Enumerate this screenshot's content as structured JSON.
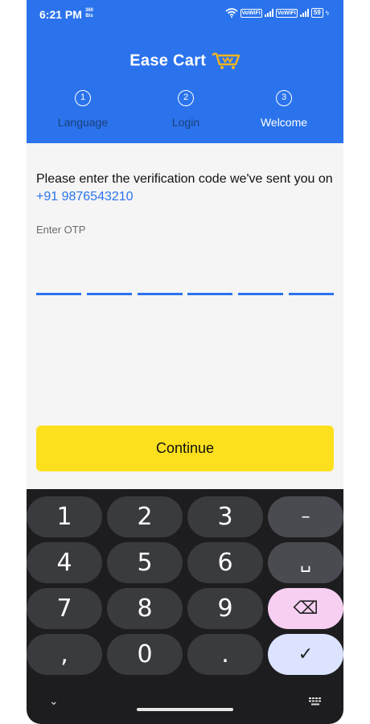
{
  "status_bar": {
    "time": "6:21 PM",
    "speed_value": "360",
    "speed_unit": "B/s",
    "vowifi_1": "VoWiFi",
    "vowifi_2": "VoWiFi",
    "battery": "59"
  },
  "header": {
    "brand_name": "Ease Cart",
    "brand_color": "#f3b51b",
    "bg_color": "#2b73ec",
    "steps": [
      {
        "number": "1",
        "label": "Language"
      },
      {
        "number": "2",
        "label": "Login"
      },
      {
        "number": "3",
        "label": "Welcome"
      }
    ]
  },
  "verification": {
    "message": "Please enter the verification code we've sent you on",
    "phone": "+91 9876543210",
    "otp_label": "Enter OTP",
    "otp_length": 6
  },
  "actions": {
    "continue_label": "Continue",
    "continue_color": "#fde01d"
  },
  "keyboard": {
    "keys": [
      "1",
      "2",
      "3",
      "–",
      "4",
      "5",
      "6",
      "␣",
      "7",
      "8",
      "9",
      "⌫",
      ",",
      "0",
      ".",
      "✓"
    ]
  }
}
